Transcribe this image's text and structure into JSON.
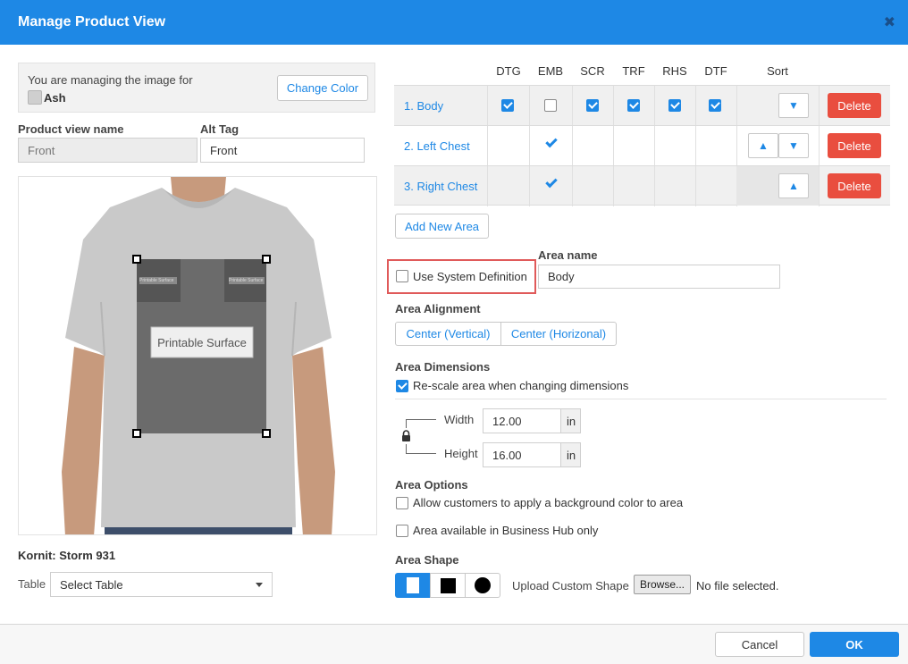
{
  "dialog": {
    "title": "Manage Product View",
    "close_glyph": "✖"
  },
  "managing": {
    "text": "You are managing the image for",
    "color_name": "Ash",
    "change_color_label": "Change Color"
  },
  "product_view_name": {
    "label": "Product view name",
    "value": "Front"
  },
  "alt_tag": {
    "label": "Alt Tag",
    "value": "Front"
  },
  "preview": {
    "printable_label": "Printable Surface",
    "small_label": "Printable Surface",
    "shirt_color": "#c9c9c9"
  },
  "printer": {
    "name": "Kornit: Storm 931"
  },
  "table": {
    "label": "Table",
    "selected": "Select Table"
  },
  "areas_table": {
    "columns": [
      "DTG",
      "EMB",
      "SCR",
      "TRF",
      "RHS",
      "DTF"
    ],
    "sort_label": "Sort",
    "delete_label": "Delete",
    "rows": [
      {
        "name": "1. Body",
        "methods": [
          true,
          false,
          true,
          true,
          true,
          true
        ],
        "style": "checkbox",
        "sort": [
          "down"
        ]
      },
      {
        "name": "2. Left Chest",
        "methods": [
          false,
          true,
          false,
          false,
          false,
          false
        ],
        "style": "tick",
        "sort": [
          "up",
          "down"
        ]
      },
      {
        "name": "3. Right Chest",
        "methods": [
          false,
          true,
          false,
          false,
          false,
          false
        ],
        "style": "tick",
        "sort": [
          "up"
        ]
      }
    ]
  },
  "add_area_label": "Add New Area",
  "use_system_definition": {
    "label": "Use System Definition",
    "checked": false
  },
  "area_name": {
    "label": "Area name",
    "value": "Body"
  },
  "alignment": {
    "label": "Area Alignment",
    "vertical": "Center (Vertical)",
    "horizontal": "Center (Horizonal)"
  },
  "dimensions": {
    "label": "Area Dimensions",
    "rescale_label": "Re-scale area when changing dimensions",
    "rescale_checked": true,
    "width_label": "Width",
    "width_value": "12.00",
    "height_label": "Height",
    "height_value": "16.00",
    "unit": "in"
  },
  "options": {
    "label": "Area Options",
    "bg_color_label": "Allow customers to apply a background color to area",
    "bg_color_checked": false,
    "business_hub_label": "Area available in Business Hub only",
    "business_hub_checked": false
  },
  "shape": {
    "label": "Area Shape",
    "upload_label": "Upload Custom Shape",
    "browse_label": "Browse...",
    "no_file": "No file selected."
  },
  "footer": {
    "cancel": "Cancel",
    "ok": "OK"
  },
  "colors": {
    "accent": "#1e88e5",
    "danger": "#e94e3f",
    "highlight": "#e05a5a"
  }
}
